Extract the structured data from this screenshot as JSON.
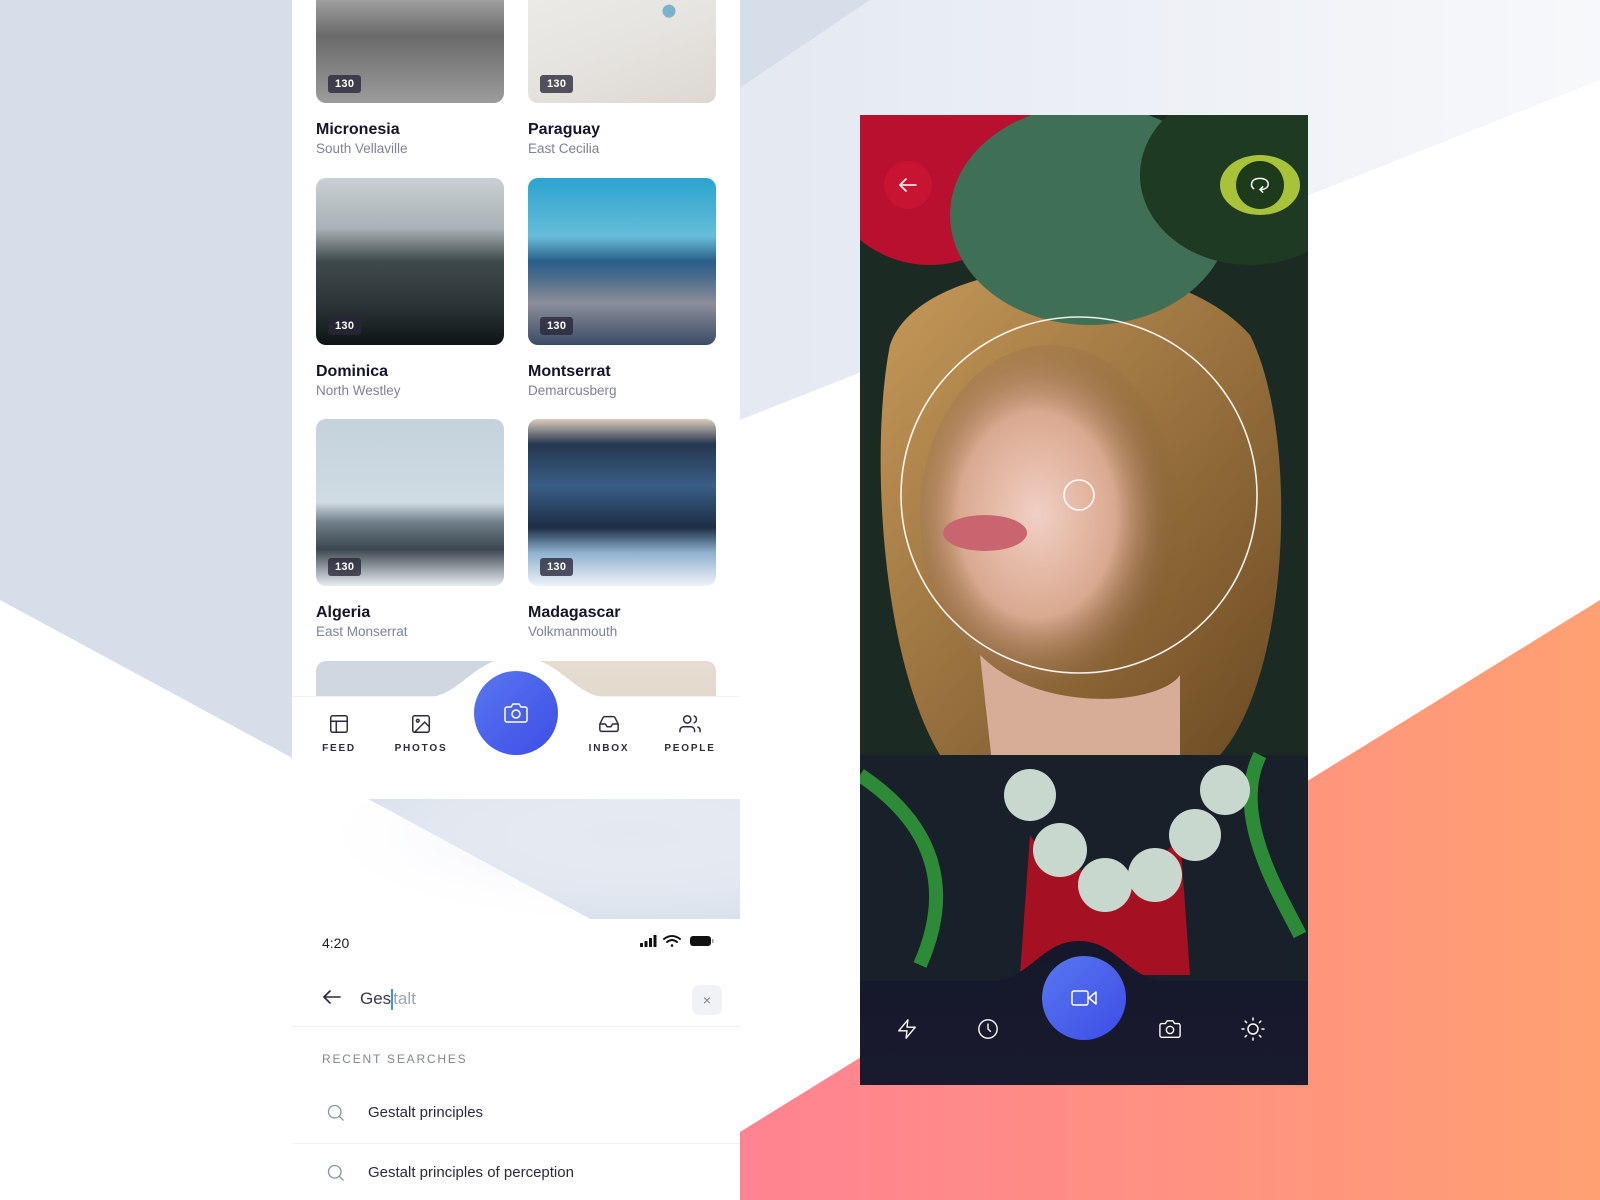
{
  "theme": {
    "accent": "#4a5cea",
    "background_blue": "#d6deea",
    "gradient_pink": "#ff7f95",
    "gradient_orange": "#ffa072",
    "text_dark": "#14142b",
    "text_muted": "#7d8297"
  },
  "feed": {
    "cards": [
      {
        "title": "Micronesia",
        "subtitle": "South Vellaville",
        "count": "130"
      },
      {
        "title": "Paraguay",
        "subtitle": "East Cecilia",
        "count": "130"
      },
      {
        "title": "Dominica",
        "subtitle": "North Westley",
        "count": "130"
      },
      {
        "title": "Montserrat",
        "subtitle": "Demarcusberg",
        "count": "130"
      },
      {
        "title": "Algeria",
        "subtitle": "East Monserrat",
        "count": "130"
      },
      {
        "title": "Madagascar",
        "subtitle": "Volkmanmouth",
        "count": "130"
      }
    ],
    "tabbar": {
      "items": [
        {
          "label": "FEED",
          "icon": "layout-icon"
        },
        {
          "label": "PHOTOS",
          "icon": "image-icon"
        },
        {
          "label": "INBOX",
          "icon": "inbox-icon"
        },
        {
          "label": "PEOPLE",
          "icon": "users-icon"
        }
      ],
      "center_action": "camera-icon"
    }
  },
  "search": {
    "status_time": "4:20",
    "query_typed": "Ges",
    "query_suggestion": "talt",
    "clear_label": "×",
    "recent_label": "RECENT SEARCHES",
    "recent": [
      {
        "text": "Gestalt principles"
      },
      {
        "text": "Gestalt principles of perception"
      }
    ]
  },
  "camera": {
    "back_icon": "arrow-left-icon",
    "rotate_icon": "rotate-icon",
    "tools": [
      {
        "icon": "flash-icon"
      },
      {
        "icon": "timer-icon"
      },
      {
        "icon": "video-icon"
      },
      {
        "icon": "camera-icon"
      },
      {
        "icon": "brightness-icon"
      }
    ]
  }
}
